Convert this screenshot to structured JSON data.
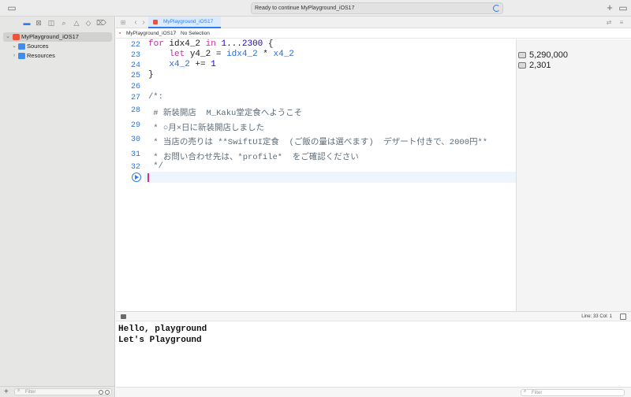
{
  "toolbar": {
    "status_text": "Ready to continue MyPlayground_iOS17",
    "add_icon": "+",
    "sidebar_toggle_icon": "sidebar-icon",
    "inspector_icon": "inspector-icon"
  },
  "navigator": {
    "items": [
      {
        "label": "MyPlayground_iOS17",
        "expanded": true,
        "icon": "swift-file-icon"
      },
      {
        "label": "Sources",
        "expanded": true,
        "icon": "folder-icon"
      },
      {
        "label": "Resources",
        "expanded": false,
        "icon": "folder-icon"
      }
    ],
    "filter_placeholder": "Filter"
  },
  "tab": {
    "label": "MyPlayground_iOS17"
  },
  "jumpbar": {
    "file": "MyPlayground_iOS17",
    "separator": "〉",
    "selection": "No Selection"
  },
  "code": {
    "lines": [
      {
        "n": "22"
      },
      {
        "n": "23"
      },
      {
        "n": "24"
      },
      {
        "n": "25"
      },
      {
        "n": "26"
      },
      {
        "n": "27",
        "text": "/*:"
      },
      {
        "n": "28",
        "text": " # 新装開店  M_Kaku堂定食へようこそ"
      },
      {
        "n": "29",
        "text": " * ○月×日に新装開店しました"
      },
      {
        "n": "30",
        "text": " * 当店の売りは **SwiftUI定食  (ご飯の量は選べます)  デザート付きで、2000円**"
      },
      {
        "n": "31",
        "text": " * お問い合わせ先は、*profile*  をご確認ください"
      },
      {
        "n": "32",
        "text": " */"
      }
    ],
    "tokens": {
      "for": "for",
      "idx": "idx4_2",
      "in": "in",
      "range_start": "1",
      "range_op": "...",
      "range_end": "2300",
      "open_brace": "{",
      "let": "let",
      "y": "y4_2",
      "assign": "=",
      "rhs1": "idx4_2",
      "mul": "*",
      "rhs2": "x4_2",
      "x": "x4_2",
      "plus_assign": "+=",
      "one": "1",
      "close_brace": "}"
    }
  },
  "results": [
    {
      "value": "5,290,000"
    },
    {
      "value": "2,301"
    }
  ],
  "debug": {
    "line_col": "Line: 33  Col: 1"
  },
  "console": {
    "output": [
      "Hello, playground",
      "Let's Playground"
    ],
    "filter_placeholder": "Filter"
  }
}
